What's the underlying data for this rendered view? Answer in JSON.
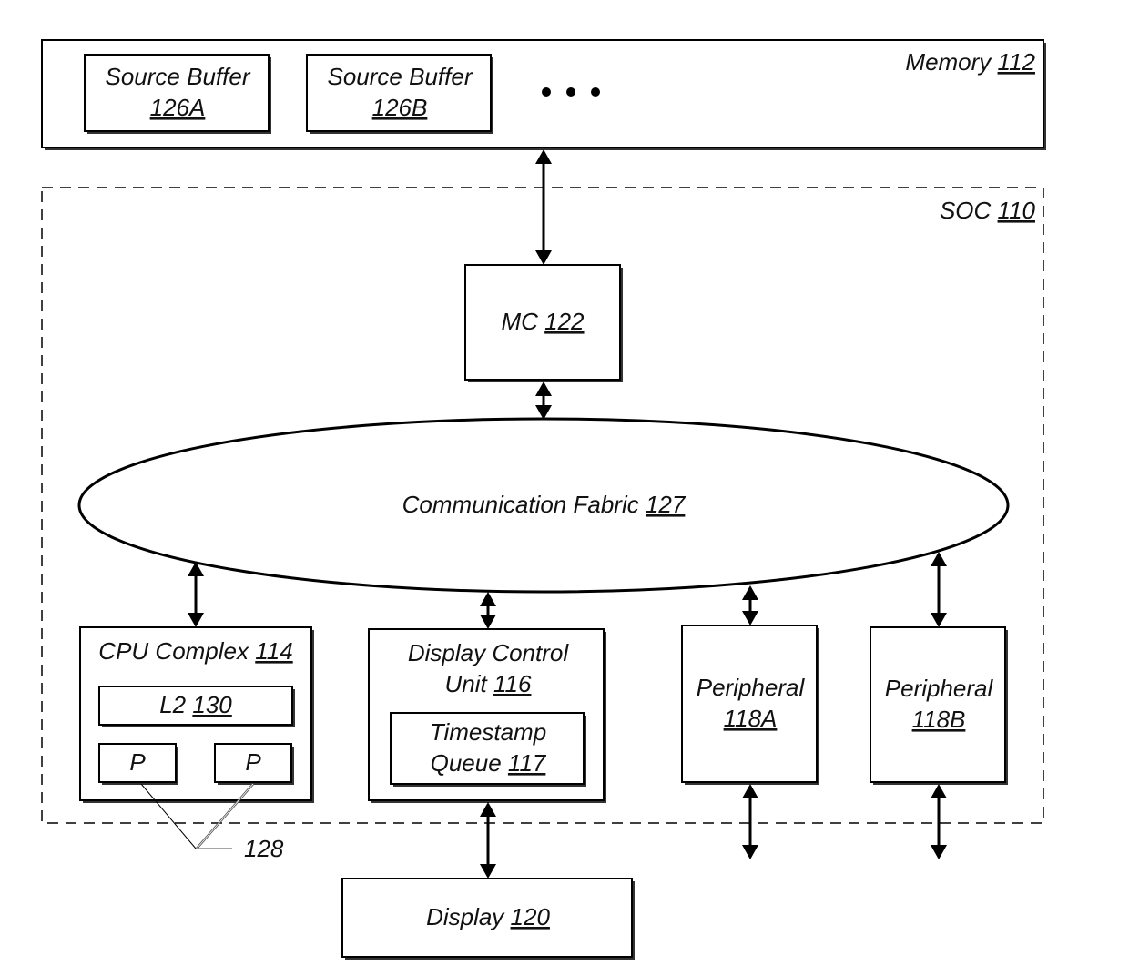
{
  "memory": {
    "label": "Memory",
    "ref": "112"
  },
  "source_buffers": [
    {
      "label": "Source Buffer",
      "ref": "126A"
    },
    {
      "label": "Source Buffer",
      "ref": "126B"
    }
  ],
  "ellipsis": "• • •",
  "soc": {
    "label": "SOC",
    "ref": "110"
  },
  "mc": {
    "label": "MC",
    "ref": "122"
  },
  "fabric": {
    "label": "Communication Fabric",
    "ref": "127"
  },
  "cpu": {
    "label": "CPU Complex",
    "ref": "114",
    "l2": {
      "label": "L2",
      "ref": "130"
    },
    "processors": [
      "P",
      "P"
    ],
    "processor_ref": "128"
  },
  "dcu": {
    "label_line1": "Display Control",
    "label_line2": "Unit",
    "ref": "116",
    "queue": {
      "label_line1": "Timestamp",
      "label_line2": "Queue",
      "ref": "117"
    }
  },
  "peripherals": [
    {
      "label": "Peripheral",
      "ref": "118A"
    },
    {
      "label": "Peripheral",
      "ref": "118B"
    }
  ],
  "display": {
    "label": "Display",
    "ref": "120"
  }
}
